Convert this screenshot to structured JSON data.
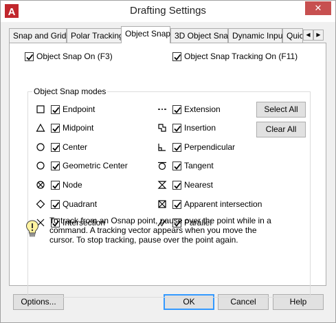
{
  "window": {
    "title": "Drafting Settings",
    "close_label": "✕"
  },
  "tabs": [
    {
      "label": "Snap and Grid"
    },
    {
      "label": "Polar Tracking"
    },
    {
      "label": "Object Snap"
    },
    {
      "label": "3D Object Snap"
    },
    {
      "label": "Dynamic Input"
    },
    {
      "label": "Quic"
    }
  ],
  "tab_scroll": {
    "left": "◀",
    "right": "▶"
  },
  "options": {
    "snap_on": {
      "label": "Object Snap On (F3)",
      "checked": true
    },
    "tracking_on": {
      "label": "Object Snap Tracking On (F11)",
      "checked": true
    }
  },
  "modes": {
    "title": "Object Snap modes",
    "left": [
      {
        "label": "Endpoint",
        "icon": "square-icon",
        "checked": true
      },
      {
        "label": "Midpoint",
        "icon": "triangle-icon",
        "checked": true
      },
      {
        "label": "Center",
        "icon": "circle-icon",
        "checked": true
      },
      {
        "label": "Geometric Center",
        "icon": "geometric-center-icon",
        "checked": true
      },
      {
        "label": "Node",
        "icon": "node-icon",
        "checked": true
      },
      {
        "label": "Quadrant",
        "icon": "diamond-icon",
        "checked": true
      },
      {
        "label": "Intersection",
        "icon": "x-icon",
        "checked": true
      }
    ],
    "right": [
      {
        "label": "Extension",
        "icon": "extension-icon",
        "checked": true
      },
      {
        "label": "Insertion",
        "icon": "insertion-icon",
        "checked": true
      },
      {
        "label": "Perpendicular",
        "icon": "perpendicular-icon",
        "checked": true
      },
      {
        "label": "Tangent",
        "icon": "tangent-icon",
        "checked": true
      },
      {
        "label": "Nearest",
        "icon": "hourglass-icon",
        "checked": true
      },
      {
        "label": "Apparent intersection",
        "icon": "apparent-intersection-icon",
        "checked": true
      },
      {
        "label": "Parallel",
        "icon": "parallel-icon",
        "checked": true
      }
    ],
    "select_all": "Select All",
    "clear_all": "Clear All"
  },
  "tip": {
    "icon": "lightbulb-icon",
    "text": "To track from an Osnap point, pause over the point while in a command.  A tracking vector appears when you move the cursor.  To stop tracking, pause over the point again."
  },
  "footer": {
    "options": "Options...",
    "ok": "OK",
    "cancel": "Cancel",
    "help": "Help"
  },
  "colors": {
    "title_accent": "#c1272d",
    "close_red": "#c75050",
    "default_button_border": "#3399ff"
  }
}
